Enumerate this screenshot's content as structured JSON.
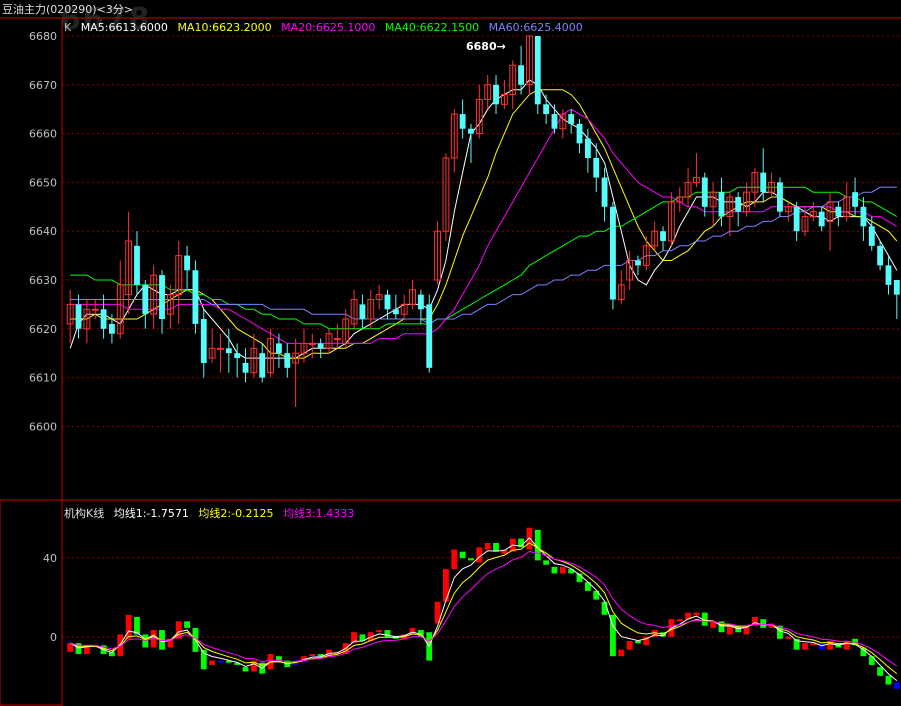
{
  "title": "豆油主力(020290)<3分>",
  "watermark": "6678",
  "colors": {
    "up": "#ff3232",
    "down": "#54fcfc",
    "grid": "#8b0000",
    "frame": "#c00000",
    "ma5": "#ffffff",
    "ma10": "#ffff00",
    "ma20": "#ff00ff",
    "ma40": "#00ff00",
    "ma60": "#8080ff",
    "ind_up": "#ff0000",
    "ind_down": "#00ff00",
    "ind_mid": "#0000ff",
    "line1": "#ffffff",
    "line2": "#ffff00",
    "line3": "#ff00ff"
  },
  "legend_top": {
    "k": "K",
    "ma5": "MA5:6613.6000",
    "ma10": "MA10:6623.2000",
    "ma20": "MA20:6625.1000",
    "ma40": "MA40:6622.1500",
    "ma60": "MA60:6625.4000"
  },
  "legend_bottom": {
    "name": "机构K线",
    "l1": "均线1:-1.7571",
    "l2": "均线2:-0.2125",
    "l3": "均线3:1.4333"
  },
  "high_marker": "6680→",
  "chart_data": [
    {
      "type": "candlestick",
      "y_ticks": [
        6600,
        6610,
        6620,
        6630,
        6640,
        6650,
        6660,
        6670,
        6680
      ],
      "ylim": [
        6597,
        6681.5
      ],
      "grid": true,
      "candles": [
        [
          6621,
          6625,
          6628,
          6617
        ],
        [
          6625,
          6620,
          6627,
          6618
        ],
        [
          6620,
          6624,
          6626,
          6617
        ],
        [
          6624,
          6624,
          6626,
          6622
        ],
        [
          6624,
          6620,
          6627,
          6618
        ],
        [
          6621,
          6619,
          6623,
          6617
        ],
        [
          6619,
          6629,
          6634,
          6618
        ],
        [
          6627,
          6638,
          6644,
          6623
        ],
        [
          6637,
          6629,
          6640,
          6627
        ],
        [
          6629,
          6623,
          6630,
          6620
        ],
        [
          6623,
          6631,
          6633,
          6620
        ],
        [
          6631,
          6622,
          6632,
          6619
        ],
        [
          6623,
          6627,
          6629,
          6620
        ],
        [
          6627,
          6635,
          6638,
          6621
        ],
        [
          6635,
          6632,
          6637,
          6628
        ],
        [
          6632,
          6621,
          6634,
          6619
        ],
        [
          6622,
          6613,
          6624,
          6610
        ],
        [
          6614,
          6616,
          6620,
          6613
        ],
        [
          6616,
          6616,
          6619,
          6611
        ],
        [
          6616,
          6615,
          6620,
          6611
        ],
        [
          6615,
          6614,
          6617,
          6610
        ],
        [
          6613,
          6611,
          6616,
          6609
        ],
        [
          6611,
          6616,
          6619,
          6610
        ],
        [
          6615,
          6610,
          6617,
          6609
        ],
        [
          6611,
          6618,
          6620,
          6610
        ],
        [
          6617,
          6615,
          6619,
          6612
        ],
        [
          6615,
          6612,
          6617,
          6610
        ],
        [
          6613,
          6615,
          6618,
          6604
        ],
        [
          6615,
          6617,
          6620,
          6613
        ],
        [
          6617,
          6617,
          6619,
          6614
        ],
        [
          6617,
          6616,
          6618,
          6614
        ],
        [
          6616,
          6619,
          6620,
          6615
        ],
        [
          6618,
          6618,
          6621,
          6616
        ],
        [
          6617,
          6622,
          6624,
          6616
        ],
        [
          6621,
          6626,
          6628,
          6620
        ],
        [
          6625,
          6622,
          6627,
          6620
        ],
        [
          6622,
          6626,
          6628,
          6620
        ],
        [
          6626,
          6627,
          6629,
          6624
        ],
        [
          6627,
          6624,
          6628,
          6622
        ],
        [
          6624,
          6623,
          6627,
          6622
        ],
        [
          6623,
          6625,
          6627,
          6622
        ],
        [
          6625,
          6628,
          6630,
          6624
        ],
        [
          6627,
          6624,
          6628,
          6621
        ],
        [
          6625,
          6612,
          6627,
          6611
        ],
        [
          6630,
          6640,
          6642,
          6629
        ],
        [
          6640,
          6655,
          6656,
          6638
        ],
        [
          6655,
          6664,
          6665,
          6652
        ],
        [
          6664,
          6661,
          6667,
          6659
        ],
        [
          6661,
          6660,
          6662,
          6654
        ],
        [
          6660,
          6667,
          6670,
          6659
        ],
        [
          6667,
          6670,
          6672,
          6665
        ],
        [
          6670,
          6666,
          6672,
          6664
        ],
        [
          6666,
          6668,
          6671,
          6665
        ],
        [
          6668,
          6674,
          6675,
          6665
        ],
        [
          6674,
          6670,
          6678,
          6668
        ],
        [
          6670,
          6680,
          6680,
          6668
        ],
        [
          6680,
          6666,
          6680,
          6664
        ],
        [
          6666,
          6664,
          6668,
          6662
        ],
        [
          6664,
          6661,
          6666,
          6660
        ],
        [
          6661,
          6664,
          6665,
          6659
        ],
        [
          6664,
          6662,
          6665,
          6660
        ],
        [
          6662,
          6658,
          6663,
          6656
        ],
        [
          6659,
          6655,
          6661,
          6652
        ],
        [
          6655,
          6651,
          6658,
          6648
        ],
        [
          6651,
          6645,
          6653,
          6642
        ],
        [
          6645,
          6626,
          6646,
          6624
        ],
        [
          6626,
          6629,
          6632,
          6625
        ],
        [
          6630,
          6634,
          6636,
          6628
        ],
        [
          6634,
          6633,
          6635,
          6631
        ],
        [
          6633,
          6637,
          6639,
          6632
        ],
        [
          6637,
          6640,
          6642,
          6636
        ],
        [
          6640,
          6638,
          6641,
          6636
        ],
        [
          6638,
          6646,
          6648,
          6637
        ],
        [
          6646,
          6647,
          6649,
          6644
        ],
        [
          6647,
          6650,
          6653,
          6645
        ],
        [
          6650,
          6651,
          6656,
          6649
        ],
        [
          6651,
          6645,
          6652,
          6643
        ],
        [
          6645,
          6648,
          6650,
          6641
        ],
        [
          6648,
          6643,
          6651,
          6641
        ],
        [
          6643,
          6647,
          6648,
          6639
        ],
        [
          6647,
          6644,
          6648,
          6641
        ],
        [
          6644,
          6648,
          6650,
          6643
        ],
        [
          6648,
          6652,
          6653,
          6645
        ],
        [
          6652,
          6648,
          6657,
          6646
        ],
        [
          6648,
          6650,
          6652,
          6647
        ],
        [
          6650,
          6644,
          6651,
          6643
        ],
        [
          6644,
          6645,
          6646,
          6642
        ],
        [
          6645,
          6640,
          6646,
          6638
        ],
        [
          6640,
          6643,
          6645,
          6639
        ],
        [
          6643,
          6644,
          6646,
          6642
        ],
        [
          6644,
          6641,
          6645,
          6640
        ],
        [
          6642,
          6646,
          6648,
          6636
        ],
        [
          6645,
          6643,
          6646,
          6641
        ],
        [
          6643,
          6647,
          6650,
          6642
        ],
        [
          6648,
          6645,
          6651,
          6643
        ],
        [
          6645,
          6641,
          6647,
          6638
        ],
        [
          6641,
          6637,
          6643,
          6636
        ],
        [
          6637,
          6633,
          6638,
          6632
        ],
        [
          6633,
          6629,
          6635,
          6627
        ],
        [
          6630,
          6627,
          6630,
          6622
        ]
      ],
      "ma": {
        "ma5": [
          6616,
          6621,
          6623,
          6623,
          6623,
          6622,
          6621,
          6624,
          6627,
          6629,
          6628,
          6627,
          6627,
          6628,
          6628,
          6628,
          6624,
          6622,
          6620,
          6618,
          6615,
          6614,
          6614,
          6614,
          6614,
          6614,
          6614,
          6614,
          6615,
          6616,
          6616,
          6616,
          6616,
          6617,
          6619,
          6620,
          6621,
          6622,
          6623,
          6624,
          6625,
          6625,
          6625,
          6624,
          6628,
          6634,
          6644,
          6652,
          6660,
          6662,
          6665,
          6667,
          6668,
          6669,
          6669,
          6671,
          6670,
          6667,
          6665,
          6663,
          6662,
          6661,
          6659,
          6657,
          6654,
          6647,
          6640,
          6633,
          6630,
          6629,
          6632,
          6634,
          6637,
          6641,
          6644,
          6647,
          6647,
          6647,
          6646,
          6646,
          6646,
          6645,
          6646,
          6648,
          6648,
          6647,
          6646,
          6645,
          6644,
          6643,
          6643,
          6642,
          6643,
          6643,
          6643,
          6643,
          6641,
          6638,
          6635,
          6632
        ],
        "ma10": [
          6622,
          6622,
          6622,
          6623,
          6622,
          6622,
          6622,
          6622,
          6622,
          6623,
          6624,
          6625,
          6626,
          6627,
          6628,
          6628,
          6627,
          6626,
          6624,
          6622,
          6620,
          6619,
          6618,
          6617,
          6615,
          6615,
          6614,
          6614,
          6614,
          6615,
          6615,
          6615,
          6616,
          6616,
          6617,
          6617,
          6618,
          6619,
          6620,
          6621,
          6622,
          6622,
          6622,
          6622,
          6625,
          6629,
          6634,
          6639,
          6643,
          6647,
          6651,
          6656,
          6660,
          6664,
          6666,
          6668,
          6669,
          6669,
          6669,
          6669,
          6668,
          6666,
          6663,
          6660,
          6657,
          6653,
          6649,
          6645,
          6641,
          6638,
          6636,
          6634,
          6634,
          6635,
          6636,
          6638,
          6640,
          6641,
          6643,
          6644,
          6645,
          6646,
          6646,
          6646,
          6647,
          6647,
          6646,
          6645,
          6645,
          6645,
          6645,
          6644,
          6644,
          6644,
          6643,
          6643,
          6642,
          6641,
          6640,
          6638
        ],
        "ma20": [
          6625,
          6625,
          6625,
          6625,
          6625,
          6625,
          6625,
          6624,
          6624,
          6624,
          6624,
          6624,
          6624,
          6625,
          6625,
          6625,
          6625,
          6625,
          6624,
          6624,
          6623,
          6622,
          6621,
          6620,
          6619,
          6618,
          6617,
          6617,
          6617,
          6617,
          6617,
          6617,
          6617,
          6617,
          6617,
          6617,
          6617,
          6618,
          6618,
          6618,
          6619,
          6619,
          6619,
          6619,
          6620,
          6622,
          6624,
          6627,
          6630,
          6633,
          6637,
          6640,
          6643,
          6646,
          6649,
          6652,
          6655,
          6658,
          6661,
          6664,
          6665,
          6664,
          6663,
          6661,
          6659,
          6656,
          6654,
          6652,
          6650,
          6649,
          6648,
          6647,
          6647,
          6646,
          6645,
          6645,
          6644,
          6644,
          6644,
          6644,
          6644,
          6644,
          6644,
          6644,
          6645,
          6645,
          6645,
          6645,
          6645,
          6645,
          6645,
          6645,
          6644,
          6644,
          6644,
          6644,
          6643,
          6643,
          6642,
          6641
        ],
        "ma40": [
          6631,
          6631,
          6631,
          6630,
          6630,
          6630,
          6629,
          6629,
          6629,
          6629,
          6629,
          6629,
          6628,
          6628,
          6628,
          6627,
          6627,
          6626,
          6626,
          6625,
          6625,
          6624,
          6624,
          6623,
          6623,
          6622,
          6622,
          6622,
          6621,
          6621,
          6621,
          6620,
          6620,
          6620,
          6620,
          6620,
          6620,
          6620,
          6621,
          6621,
          6621,
          6621,
          6621,
          6621,
          6622,
          6622,
          6623,
          6624,
          6625,
          6626,
          6627,
          6628,
          6629,
          6630,
          6631,
          6633,
          6634,
          6635,
          6636,
          6637,
          6638,
          6639,
          6639,
          6640,
          6640,
          6641,
          6641,
          6642,
          6643,
          6644,
          6645,
          6646,
          6646,
          6647,
          6647,
          6648,
          6648,
          6648,
          6648,
          6648,
          6649,
          6649,
          6649,
          6649,
          6649,
          6649,
          6649,
          6649,
          6649,
          6648,
          6648,
          6648,
          6648,
          6647,
          6647,
          6646,
          6646,
          6645,
          6644,
          6643
        ],
        "ma60": [
          6626,
          6626,
          6626,
          6626,
          6626,
          6626,
          6626,
          6626,
          6626,
          6626,
          6626,
          6626,
          6626,
          6626,
          6626,
          6626,
          6626,
          6625,
          6625,
          6625,
          6625,
          6625,
          6625,
          6625,
          6624,
          6624,
          6624,
          6624,
          6624,
          6623,
          6623,
          6623,
          6623,
          6623,
          6622,
          6622,
          6622,
          6622,
          6622,
          6622,
          6622,
          6622,
          6622,
          6621,
          6622,
          6622,
          6622,
          6623,
          6623,
          6624,
          6625,
          6625,
          6626,
          6627,
          6627,
          6628,
          6629,
          6629,
          6630,
          6630,
          6631,
          6631,
          6632,
          6632,
          6633,
          6633,
          6633,
          6634,
          6634,
          6635,
          6635,
          6636,
          6636,
          6637,
          6637,
          6638,
          6638,
          6639,
          6639,
          6640,
          6640,
          6641,
          6641,
          6642,
          6642,
          6643,
          6643,
          6644,
          6644,
          6645,
          6645,
          6646,
          6646,
          6647,
          6647,
          6648,
          6648,
          6649,
          6649,
          6649
        ]
      }
    },
    {
      "type": "candlestick",
      "y_ticks": [
        0,
        40
      ],
      "ylim": [
        -17,
        60
      ],
      "series_names": [
        "均线1",
        "均线2",
        "均线3"
      ]
    }
  ]
}
